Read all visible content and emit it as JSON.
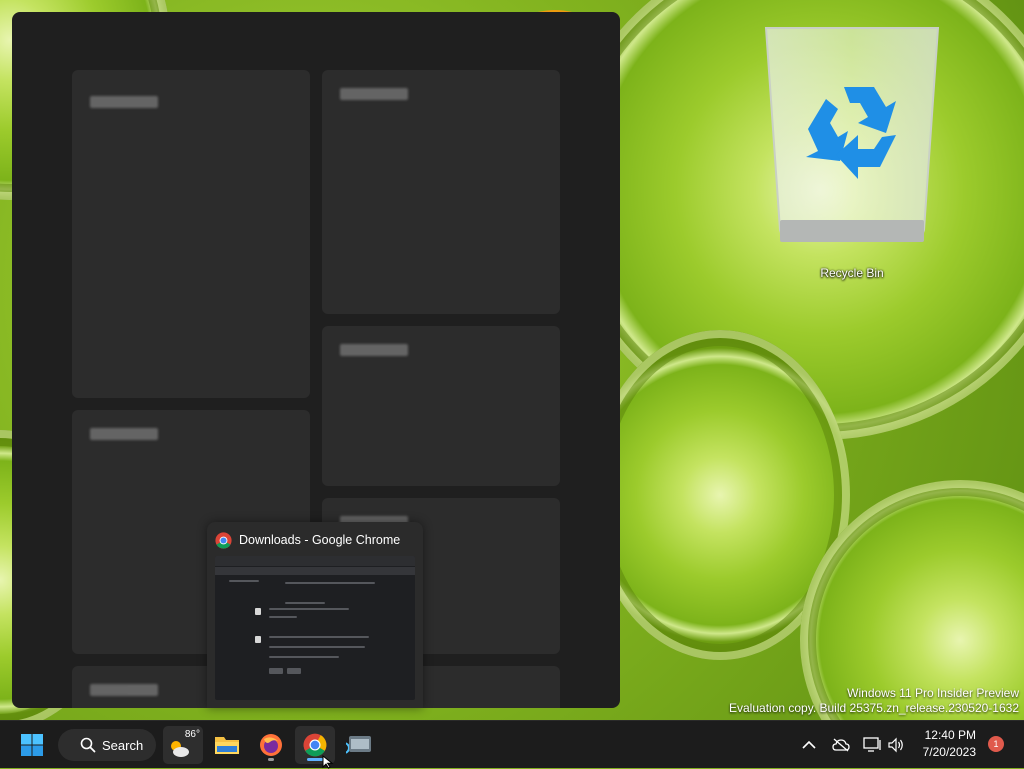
{
  "desktop": {
    "recycle_bin_label": "Recycle Bin"
  },
  "watermark": {
    "line1": "Windows 11 Pro Insider Preview",
    "line2": "Evaluation copy. Build 25375.zn_release.230520-1632"
  },
  "preview": {
    "window_title": "Downloads - Google Chrome"
  },
  "taskbar": {
    "search_label": "Search",
    "weather_temp": "86°",
    "clock_time": "12:40 PM",
    "clock_date": "7/20/2023",
    "notification_count": "1",
    "icons": [
      "start-icon",
      "search-icon",
      "weather-icon",
      "file-explorer-icon",
      "firefox-icon",
      "chrome-icon",
      "terminal-icon",
      "chevron-up-icon",
      "network-off-icon",
      "monitor-icon",
      "volume-icon"
    ]
  },
  "colors": {
    "taskbar_bg": "#1c1c1c",
    "panel_bg": "#1f1f1f",
    "accent": "#5fb2ff",
    "badge": "#e05a4c"
  }
}
